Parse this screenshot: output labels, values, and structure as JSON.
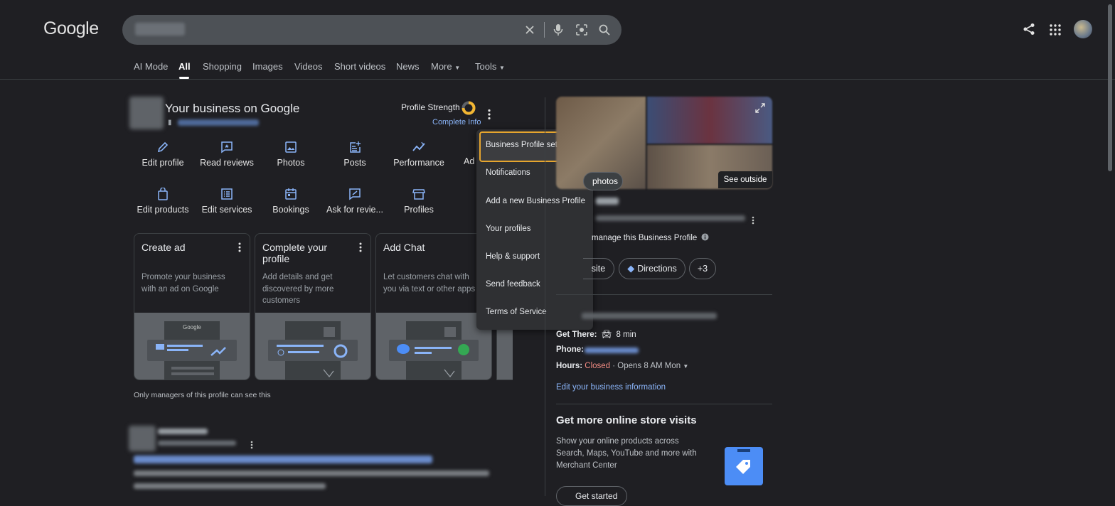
{
  "header": {
    "logo": "Google",
    "search_query": "",
    "icons": [
      "clear-icon",
      "mic-icon",
      "lens-icon",
      "search-icon"
    ],
    "right_icons": [
      "share-icon",
      "apps-icon",
      "avatar"
    ]
  },
  "tabs": [
    "AI Mode",
    "All",
    "Shopping",
    "Images",
    "Videos",
    "Short videos",
    "News",
    "More",
    "Tools"
  ],
  "business": {
    "title": "Your business on Google",
    "profile_strength": "Profile Strength",
    "complete_info": "Complete Info",
    "actions_row1": [
      "Edit profile",
      "Read reviews",
      "Photos",
      "Posts",
      "Performance",
      "Ad"
    ],
    "actions_row2": [
      "Edit products",
      "Edit services",
      "Bookings",
      "Ask for revie...",
      "Profiles"
    ],
    "cards": [
      {
        "title": "Create ad",
        "desc": "Promote your business with an ad on Google",
        "img_label": "Google"
      },
      {
        "title": "Complete your profile",
        "desc": "Add details and get discovered by more customers"
      },
      {
        "title": "Add Chat",
        "desc": "Let customers chat with you via text or other apps"
      }
    ],
    "note": "Only managers of this profile can see this"
  },
  "menu": {
    "items": [
      "Business Profile settings",
      "Notifications",
      "Add a new Business Profile",
      "Your profiles",
      "Help & support",
      "Send feedback",
      "Terms of Service"
    ]
  },
  "knowledge_panel": {
    "photos_label": "photos",
    "see_outside": "See outside",
    "manage_text": "manage this Business Profile",
    "chips": [
      "site",
      "Directions",
      "+3"
    ],
    "get_there_label": "Get There:",
    "get_there_value": "8 min",
    "phone_label": "Phone:",
    "hours_label": "Hours:",
    "hours_status": "Closed",
    "hours_next": " · Opens 8 AM Mon",
    "edit_link": "Edit your business information",
    "promo_title": "Get more online store visits",
    "promo_desc": "Show your online products across Search, Maps, YouTube and more with Merchant Center",
    "get_started": "Get started"
  },
  "colors": {
    "background": "#1f1f23",
    "link": "#8ab4f8",
    "menu_highlight": "#e6a52e",
    "closed": "#f28b82"
  }
}
